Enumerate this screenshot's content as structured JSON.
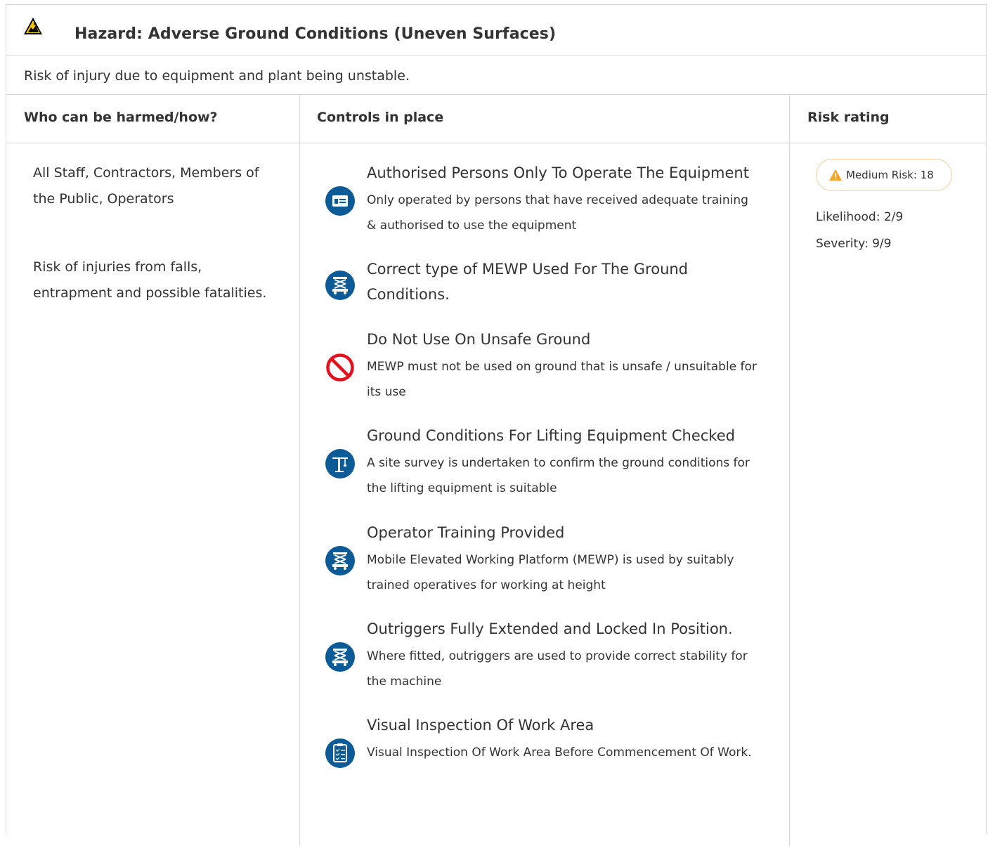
{
  "hazard": {
    "icon": "ground-hazard-icon",
    "title": "Hazard:  Adverse Ground Conditions (Uneven Surfaces)",
    "description": "Risk of injury due to equipment and plant being unstable."
  },
  "columns": {
    "who": "Who can be harmed/how?",
    "controls": "Controls in place",
    "rating": "Risk rating"
  },
  "who": {
    "people": "All Staff, Contractors, Members of the Public, Operators",
    "how": "Risk of injuries from falls, entrapment and possible fatalities."
  },
  "controls": [
    {
      "icon": "id-card-icon",
      "title": "Authorised Persons Only To Operate The Equipment",
      "detail": "Only operated by persons that have received adequate training & authorised to use the equipment"
    },
    {
      "icon": "scissor-lift-icon",
      "title": "Correct type of MEWP Used For The Ground Conditions.",
      "detail": ""
    },
    {
      "icon": "prohibition-icon",
      "title": "Do Not Use On Unsafe Ground",
      "detail": "MEWP must not be used on ground that is unsafe / unsuitable for its use"
    },
    {
      "icon": "crane-icon",
      "title": "Ground Conditions For Lifting Equipment Checked",
      "detail": "A site survey is undertaken to confirm the ground conditions for the lifting equipment is suitable"
    },
    {
      "icon": "scissor-lift-icon",
      "title": "Operator Training Provided",
      "detail": "Mobile Elevated Working Platform (MEWP) is used by suitably trained operatives for working at height"
    },
    {
      "icon": "scissor-lift-icon",
      "title": "Outriggers Fully Extended and Locked In Position.",
      "detail": "Where fitted, outriggers are used to provide correct stability for the machine"
    },
    {
      "icon": "clipboard-icon",
      "title": "Visual Inspection Of Work Area",
      "detail": "Visual Inspection Of Work Area Before Commencement Of Work."
    }
  ],
  "rating": {
    "badge": "Medium Risk: 18",
    "badge_color": "#f5a623",
    "likelihood": "Likelihood: 2/9",
    "severity": "Severity: 9/9"
  },
  "colors": {
    "icon_blue": "#0d5b96",
    "prohibition_red": "#e3101e",
    "border": "#d6d6d6"
  }
}
